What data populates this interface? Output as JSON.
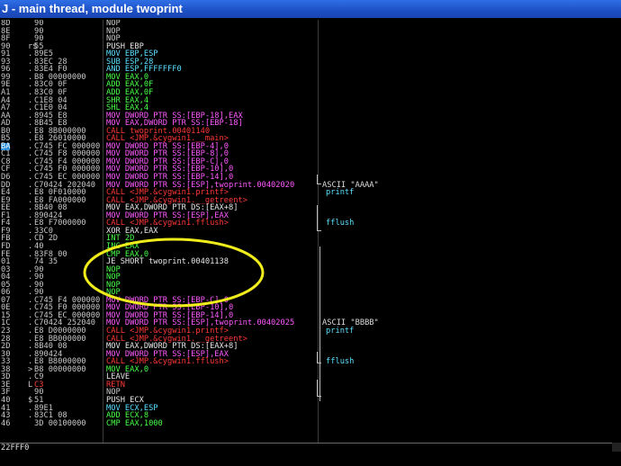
{
  "window": {
    "title": "J - main thread, module twoprint"
  },
  "colors": {
    "default": "#c8c8c8",
    "call": "#ff3838",
    "jmp": "#ffff5a",
    "mov": "#ff5aff",
    "arith": "#48ff48",
    "stack": "#5ae0ff",
    "white": "#e6e6e6",
    "annotation": "#f0ec1c"
  },
  "rows": [
    {
      "addr": "8D",
      "mark": "",
      "hex": "90",
      "dis": "NOP",
      "dc": "default"
    },
    {
      "addr": "8E",
      "mark": "",
      "hex": "90",
      "dis": "NOP",
      "dc": "default"
    },
    {
      "addr": "8F",
      "mark": "",
      "hex": "90",
      "dis": "NOP",
      "dc": "default"
    },
    {
      "addr": "90",
      "mark": "r$",
      "hex": "55",
      "dis": "PUSH EBP",
      "dc": "white"
    },
    {
      "addr": "91",
      "mark": ".",
      "hex": "89E5",
      "dis": "MOV EBP,ESP",
      "dc": "stack"
    },
    {
      "addr": "93",
      "mark": ".",
      "hex": "83EC 28",
      "dis": "SUB ESP,28",
      "dc": "stack"
    },
    {
      "addr": "96",
      "mark": ".",
      "hex": "83E4 F0",
      "dis": "AND ESP,FFFFFFF0",
      "dc": "stack"
    },
    {
      "addr": "99",
      "mark": ".",
      "hex": "B8 00000000",
      "dis": "MOV EAX,0",
      "dc": "arith"
    },
    {
      "addr": "9E",
      "mark": ".",
      "hex": "83C0 0F",
      "dis": "ADD EAX,0F",
      "dc": "arith"
    },
    {
      "addr": "A1",
      "mark": ".",
      "hex": "83C0 0F",
      "dis": "ADD EAX,0F",
      "dc": "arith"
    },
    {
      "addr": "A4",
      "mark": ".",
      "hex": "C1E8 04",
      "dis": "SHR EAX,4",
      "dc": "arith"
    },
    {
      "addr": "A7",
      "mark": ".",
      "hex": "C1E0 04",
      "dis": "SHL EAX,4",
      "dc": "arith"
    },
    {
      "addr": "AA",
      "mark": ".",
      "hex": "8945 E8",
      "dis": "MOV DWORD PTR SS:[EBP-18],EAX",
      "dc": "mov"
    },
    {
      "addr": "AD",
      "mark": ".",
      "hex": "8B45 E8",
      "dis": "MOV EAX,DWORD PTR SS:[EBP-18]",
      "dc": "mov"
    },
    {
      "addr": "B0",
      "mark": ".",
      "hex": "E8 8B000000",
      "dis": "CALL twoprint.00401140",
      "dc": "call"
    },
    {
      "addr": "B5",
      "mark": ".",
      "hex": "E8 26010000",
      "dis": "CALL <JMP.&cygwin1.__main>",
      "dc": "call"
    },
    {
      "addr": "BA",
      "mark": ".",
      "hex": "C745 FC 000000",
      "dis": "MOV DWORD PTR SS:[EBP-4],0",
      "dc": "mov",
      "hl": true
    },
    {
      "addr": "C1",
      "mark": ".",
      "hex": "C745 F8 000000",
      "dis": "MOV DWORD PTR SS:[EBP-8],0",
      "dc": "mov"
    },
    {
      "addr": "C8",
      "mark": ".",
      "hex": "C745 F4 000000",
      "dis": "MOV DWORD PTR SS:[EBP-C],0",
      "dc": "mov"
    },
    {
      "addr": "CF",
      "mark": ".",
      "hex": "C745 F0 000000",
      "dis": "MOV DWORD PTR SS:[EBP-10],0",
      "dc": "mov"
    },
    {
      "addr": "D6",
      "mark": ".",
      "hex": "C745 EC 000000",
      "dis": "MOV DWORD PTR SS:[EBP-14],0",
      "dc": "mov"
    },
    {
      "addr": "DD",
      "mark": ".",
      "hex": "C70424 202040",
      "dis": "MOV DWORD PTR SS:[ESP],twoprint.00402020",
      "dc": "mov",
      "cmt": "ASCII \"AAAA\""
    },
    {
      "addr": "E4",
      "mark": ".",
      "hex": "E8 0F010000",
      "dis": "CALL <JMP.&cygwin1.printf>",
      "dc": "call",
      "cmt": "printf",
      "cmtc": "stack"
    },
    {
      "addr": "E9",
      "mark": ".",
      "hex": "E8 FA000000",
      "dis": "CALL <JMP.&cygwin1.__getreent>",
      "dc": "call"
    },
    {
      "addr": "EE",
      "mark": ".",
      "hex": "8B40 08",
      "dis": "MOV EAX,DWORD PTR DS:[EAX+8]",
      "dc": "white"
    },
    {
      "addr": "F1",
      "mark": ".",
      "hex": "890424",
      "dis": "MOV DWORD PTR SS:[ESP],EAX",
      "dc": "mov"
    },
    {
      "addr": "F4",
      "mark": ".",
      "hex": "E8 F7000000",
      "dis": "CALL <JMP.&cygwin1.fflush>",
      "dc": "call",
      "cmt": "fflush",
      "cmtc": "stack"
    },
    {
      "addr": "F9",
      "mark": ".",
      "hex": "33C0",
      "dis": "XOR EAX,EAX",
      "dc": "white"
    },
    {
      "addr": "FB",
      "mark": ".",
      "hex": "CD 2D",
      "dis": "INT 2D",
      "dc": "arith"
    },
    {
      "addr": "FD",
      "mark": ".",
      "hex": "40",
      "dis": "INC EAX",
      "dc": "arith"
    },
    {
      "addr": "FE",
      "mark": ".",
      "hex": "83F8 00",
      "dis": "CMP EAX,0",
      "dc": "arith"
    },
    {
      "addr": "01",
      "mark": "",
      "hex": "74 35",
      "dis": "JE SHORT twoprint.00401138",
      "dc": "white"
    },
    {
      "addr": "03",
      "mark": ".",
      "hex": "90",
      "dis": "NOP",
      "dc": "arith"
    },
    {
      "addr": "04",
      "mark": ".",
      "hex": "90",
      "dis": "NOP",
      "dc": "arith"
    },
    {
      "addr": "05",
      "mark": ".",
      "hex": "90",
      "dis": "NOP",
      "dc": "arith"
    },
    {
      "addr": "06",
      "mark": ".",
      "hex": "90",
      "dis": "NOP",
      "dc": "arith"
    },
    {
      "addr": "07",
      "mark": ".",
      "hex": "C745 F4 000000",
      "dis": "MOV DWORD PTR SS:[EBP-C],0",
      "dc": "mov"
    },
    {
      "addr": "0E",
      "mark": ".",
      "hex": "C745 F0 000000",
      "dis": "MOV DWORD PTR SS:[EBP-10],0",
      "dc": "mov"
    },
    {
      "addr": "15",
      "mark": ".",
      "hex": "C745 EC 000000",
      "dis": "MOV DWORD PTR SS:[EBP-14],0",
      "dc": "mov"
    },
    {
      "addr": "1C",
      "mark": ".",
      "hex": "C70424 252040",
      "dis": "MOV DWORD PTR SS:[ESP],twoprint.00402025",
      "dc": "mov",
      "cmt": "ASCII \"BBBB\""
    },
    {
      "addr": "23",
      "mark": ".",
      "hex": "E8 D0000000",
      "dis": "CALL <JMP.&cygwin1.printf>",
      "dc": "call",
      "cmt": "printf",
      "cmtc": "stack"
    },
    {
      "addr": "28",
      "mark": ".",
      "hex": "E8 BB000000",
      "dis": "CALL <JMP.&cygwin1.__getreent>",
      "dc": "call"
    },
    {
      "addr": "2D",
      "mark": ".",
      "hex": "8B40 08",
      "dis": "MOV EAX,DWORD PTR DS:[EAX+8]",
      "dc": "white"
    },
    {
      "addr": "30",
      "mark": ".",
      "hex": "890424",
      "dis": "MOV DWORD PTR SS:[ESP],EAX",
      "dc": "mov"
    },
    {
      "addr": "33",
      "mark": ".",
      "hex": "E8 B8000000",
      "dis": "CALL <JMP.&cygwin1.fflush>",
      "dc": "call",
      "cmt": "fflush",
      "cmtc": "stack"
    },
    {
      "addr": "38",
      "mark": ">",
      "hex": "B8 00000000",
      "dis": "MOV EAX,0",
      "dc": "arith"
    },
    {
      "addr": "3D",
      "mark": ".",
      "hex": "C9",
      "dis": "LEAVE",
      "dc": "white"
    },
    {
      "addr": "3E",
      "mark": "L",
      "hex": "C3",
      "dis": "RETN",
      "dc": "call",
      "hexred": true
    },
    {
      "addr": "3F",
      "mark": "",
      "hex": "90",
      "dis": "NOP",
      "dc": "default"
    },
    {
      "addr": "40",
      "mark": "$",
      "hex": "51",
      "dis": "PUSH ECX",
      "dc": "white"
    },
    {
      "addr": "41",
      "mark": ".",
      "hex": "89E1",
      "dis": "MOV ECX,ESP",
      "dc": "stack"
    },
    {
      "addr": "43",
      "mark": ".",
      "hex": "83C1 08",
      "dis": "ADD ECX,8",
      "dc": "arith"
    },
    {
      "addr": "46",
      "mark": "",
      "hex": "3D 00100000",
      "dis": "CMP EAX,1000",
      "dc": "arith"
    }
  ],
  "status": {
    "text": "22FFF0"
  }
}
